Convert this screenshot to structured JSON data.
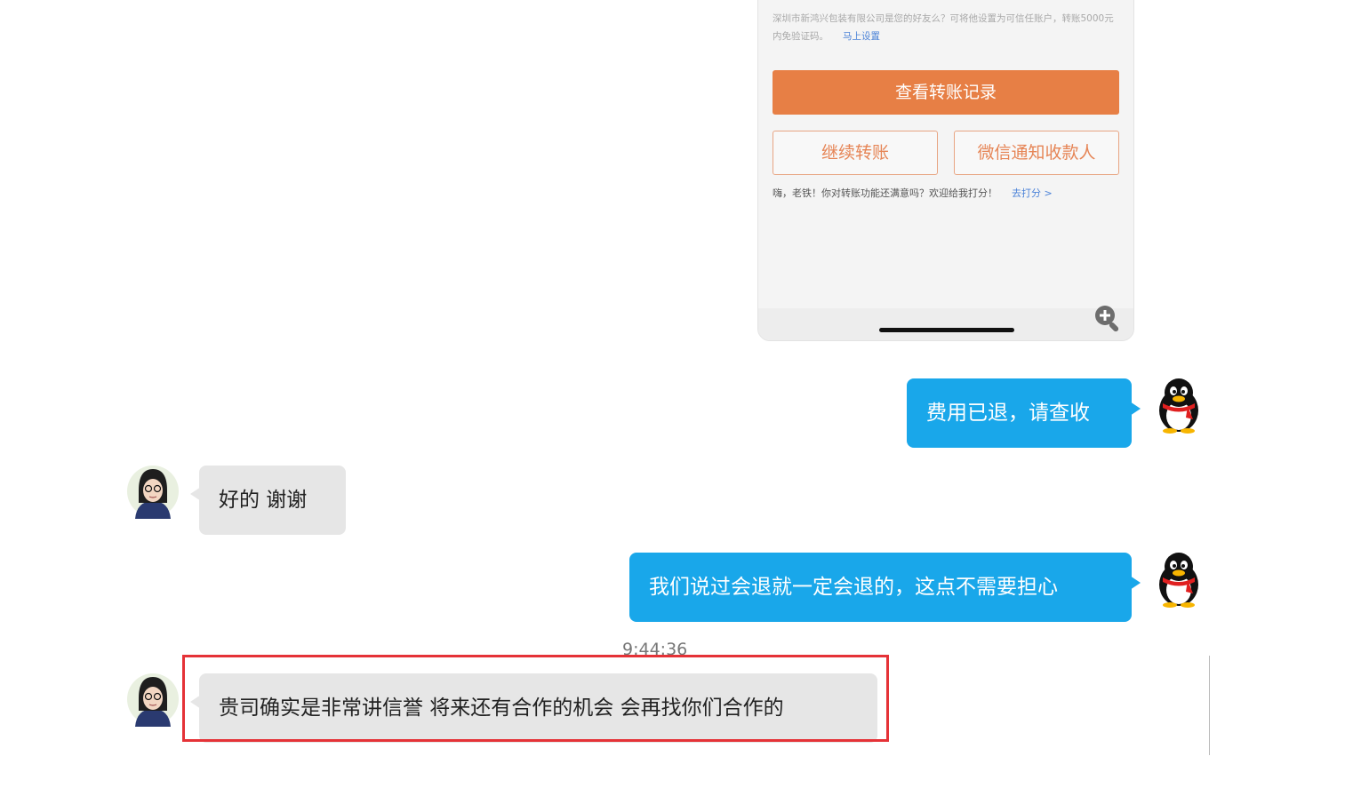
{
  "transfer_card": {
    "notice_text": "深圳市新鸿兴包装有限公司是您的好友么？可将他设置为可信任账户，转账5000元内免验证码。",
    "notice_link": "马上设置",
    "view_records_button": "查看转账记录",
    "continue_transfer_button": "继续转账",
    "wechat_notify_button": "微信通知收款人",
    "rating_text": "嗨，老铁！你对转账功能还满意吗？欢迎给我打分！",
    "rating_link": "去打分 >"
  },
  "messages": [
    {
      "side": "outgoing",
      "text": "费用已退，请查收"
    },
    {
      "side": "incoming",
      "text": "好的  谢谢"
    },
    {
      "side": "outgoing",
      "text": "我们说过会退就一定会退的，这点不需要担心"
    },
    {
      "side": "incoming",
      "text": "贵司确实是非常讲信誉 将来还有合作的机会 会再找你们合作的"
    }
  ],
  "timestamp": "9:44:36",
  "colors": {
    "outgoing_bubble": "#19a7ea",
    "incoming_bubble": "#e6e6e6",
    "primary_button": "#e77f45",
    "highlight_box": "#e53237"
  },
  "icons": {
    "outgoing_avatar": "qq-penguin-icon",
    "incoming_avatar": "user-photo-avatar",
    "zoom": "zoom-in-icon"
  }
}
